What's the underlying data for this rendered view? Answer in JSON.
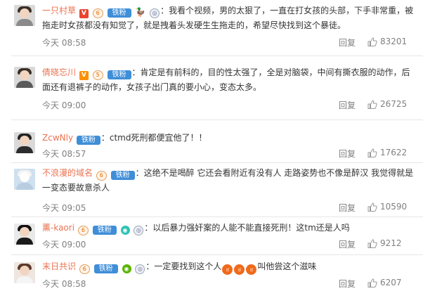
{
  "comments": [
    {
      "user": "一只村草",
      "text": "：我看个视频，男的太狠了，一直在打女孩的头部，下手非常重，被",
      "text2": "拖走时女孩都没有知觉了，就是拽着头发硬生生拖走的，希望尽快找到这个暴徒。",
      "time": "今天 08:58",
      "reply": "回复",
      "likes": "83201",
      "badge": "铁粉"
    },
    {
      "user": "倩晓忘川",
      "text": "：肯定是有前科的，目的性太强了，全是对脑袋，中间有撕衣服的动作，后",
      "text2": "面还有退裤子的动作，女孩子出门真的要小心，变态太多。",
      "time": "今天 09:00",
      "reply": "回复",
      "likes": "26725",
      "badge": "铁粉"
    },
    {
      "user": "ZcwNly",
      "text": "：ctmd死刑都便宜他了！！",
      "time": "今天 08:57",
      "reply": "回复",
      "likes": "17622",
      "badge": "铁粉"
    },
    {
      "user": "不浪漫的域名",
      "text": "：这绝不是喝醉 它还会看附近有没有人 走路姿势也不像是醉汉 我觉得就是",
      "text2": "一变态要故意杀人",
      "time": "今天 09:05",
      "reply": "回复",
      "likes": "10590",
      "badge": "铁粉"
    },
    {
      "user": "薰-kaori",
      "text": "：以后暴力强奸案的人能不能直接死刑！这tm还是人吗",
      "time": "今天 09:00",
      "reply": "回复",
      "likes": "9212",
      "badge": "铁粉"
    },
    {
      "user": "末日共识",
      "text": "：一定要找到这个人",
      "text_after": "叫他尝这个滋味",
      "time": "今天 08:58",
      "reply": "回复",
      "likes": "6207",
      "badge": "铁粉"
    }
  ]
}
